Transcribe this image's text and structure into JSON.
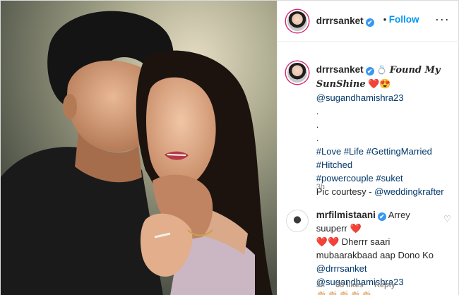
{
  "header": {
    "username": "drrrsanket",
    "verified_mark": "✔",
    "separator": "•",
    "follow_label": "Follow",
    "more_label": "···"
  },
  "caption": {
    "username": "drrrsanket",
    "emoji_ring": "💍",
    "title": "Found My SunShine",
    "heart": "❤️",
    "smile": "😍",
    "mention": "@sugandhamishra23",
    "dots": [
      ".",
      ".",
      "."
    ],
    "hashtags_line1": "#Love #Life #GettingMarried #Hitched",
    "hashtags_line2": "#powercouple #suket",
    "credit_prefix": "Pic courtesy - ",
    "credit_mention": "@weddingkrafter",
    "time": "3h"
  },
  "comment": {
    "username": "mrfilmistaani",
    "text1": "Arrey suuperr",
    "heart1": "❤️",
    "hearts2": "❤️❤️",
    "text2": "Dherrr saari",
    "text3": "mubaarakbaad aap Dono Ko",
    "mention1": "@drrrsanket",
    "mention2": "@sugandhamishra23",
    "claps": "👏🏻👏🏻👏🏻👏🏻👏🏻",
    "like_icon": "♡",
    "time": "3h",
    "likes": "68 likes",
    "reply": "Reply"
  },
  "colors": {
    "link_blue": "#0095f6",
    "mention_blue": "#00376b",
    "verified_blue": "#3897f0",
    "heart_red": "#ed4956"
  }
}
